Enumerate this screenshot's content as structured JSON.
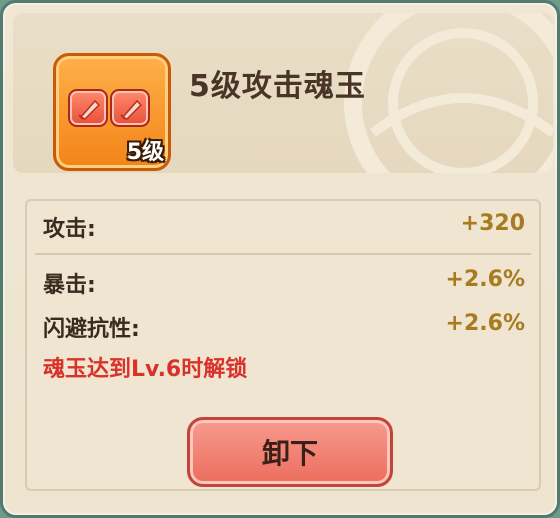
{
  "item": {
    "name": "5级攻击魂玉",
    "level_badge": "5级",
    "icon": "soul-jade-icon"
  },
  "stats": [
    {
      "label": "攻击:",
      "value": "+320"
    },
    {
      "label": "暴击:",
      "value": "+2.6%"
    },
    {
      "label": "闪避抗性:",
      "value": "+2.6%"
    }
  ],
  "unlock_note": "魂玉达到Lv.6时解锁",
  "actions": {
    "unequip_label": "卸下"
  },
  "colors": {
    "value_gold": "#a67c1e",
    "warning_red": "#d8322a",
    "button_red": "#ec6d5d"
  }
}
